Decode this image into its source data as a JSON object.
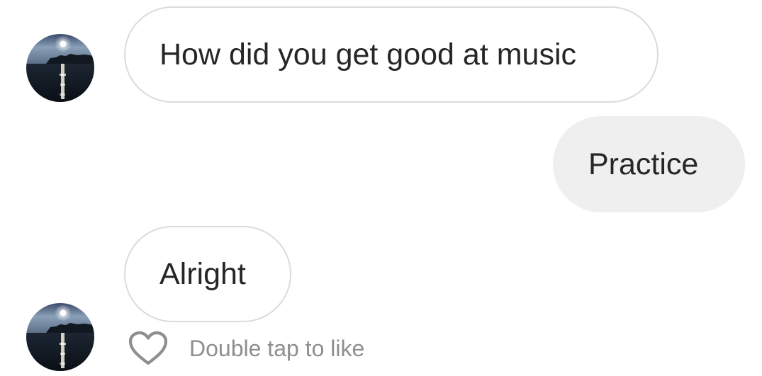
{
  "conversation": {
    "messages": [
      {
        "sender": "other",
        "text": "How did you get good at music"
      },
      {
        "sender": "self",
        "text": "Practice"
      },
      {
        "sender": "other",
        "text": "Alright"
      }
    ],
    "like_hint": "Double tap to like"
  },
  "icons": {
    "avatar": "moon-over-lake-avatar",
    "like": "heart-outline-icon"
  },
  "colors": {
    "incoming_bubble_border": "#dbdbdb",
    "outgoing_bubble_bg": "#efefef",
    "text": "#262626",
    "hint_text": "#8e8e8e"
  }
}
